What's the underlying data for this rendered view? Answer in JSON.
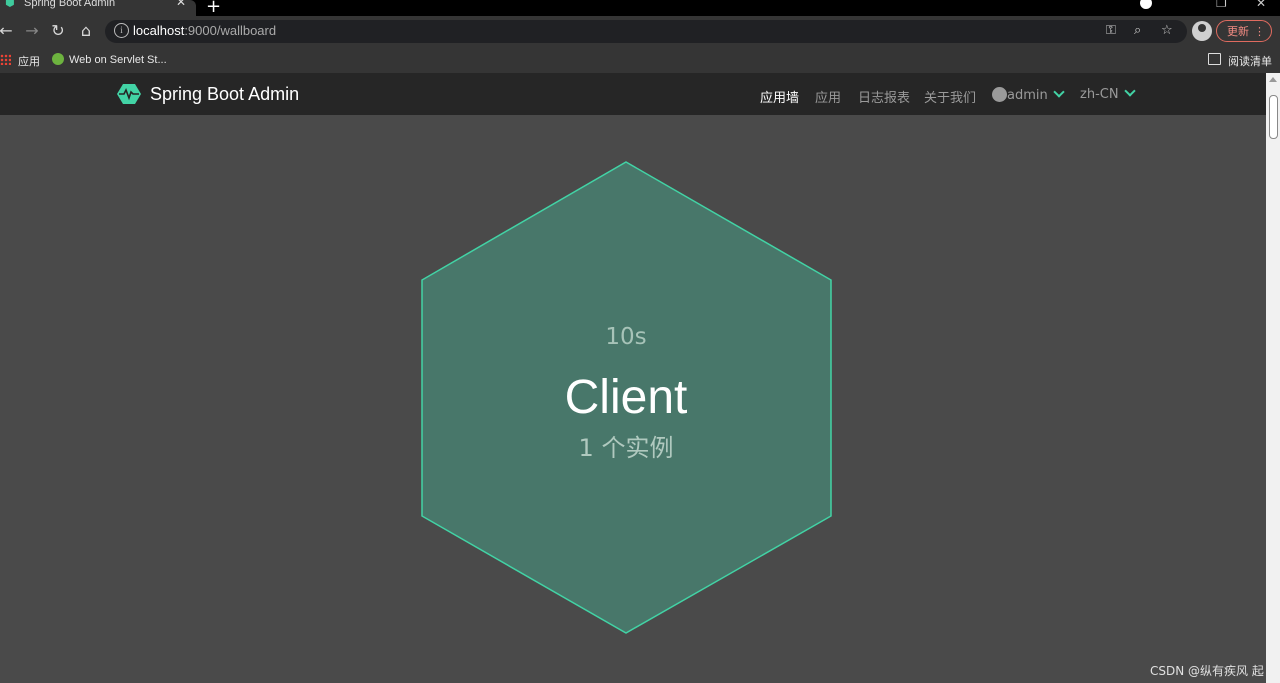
{
  "browser": {
    "tab_title": "Spring Boot Admin",
    "address": {
      "host": "localhost",
      "path": ":9000/wallboard"
    },
    "update_label": "更新",
    "bookmarks": {
      "apps_label": "应用",
      "bookmark1": "Web on Servlet St...",
      "reading_list": "阅读清单"
    }
  },
  "app": {
    "brand": "Spring Boot Admin",
    "nav": {
      "wallboard": "应用墙",
      "applications": "应用",
      "logfile": "日志报表",
      "about": "关于我们",
      "user": "admin",
      "language": "zh-CN"
    },
    "accent_color": "#42d3a5"
  },
  "wallboard": {
    "app_time": "10s",
    "app_name": "Client",
    "instances": "1 个实例",
    "hex_fill": "#48776a",
    "hex_stroke": "#42d3a5"
  },
  "watermark": "CSDN @纵有疾风 起"
}
